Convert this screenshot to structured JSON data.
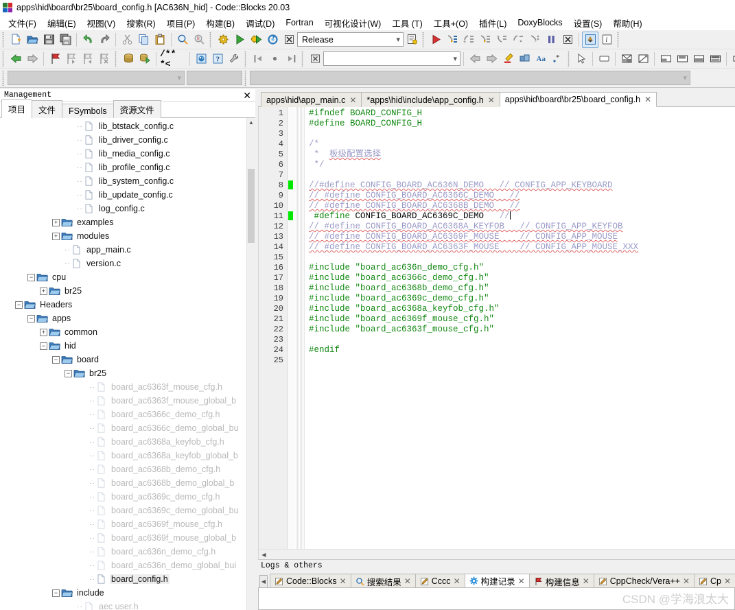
{
  "window": {
    "title": "apps\\hid\\board\\br25\\board_config.h [AC636N_hid] - Code::Blocks 20.03",
    "logo": "codeblocks-logo"
  },
  "menubar": {
    "items": [
      {
        "label": "文件(F)"
      },
      {
        "label": "编辑(E)"
      },
      {
        "label": "视图(V)"
      },
      {
        "label": "搜索(R)"
      },
      {
        "label": "项目(P)"
      },
      {
        "label": "构建(B)"
      },
      {
        "label": "调试(D)"
      },
      {
        "label": "Fortran"
      },
      {
        "label": "可视化设计(W)"
      },
      {
        "label": "工具 (T)"
      },
      {
        "label": "工具+(O)"
      },
      {
        "label": "插件(L)"
      },
      {
        "label": "DoxyBlocks"
      },
      {
        "label": "设置(S)"
      },
      {
        "label": "帮助(H)"
      }
    ]
  },
  "toolbar1": {
    "icons": [
      "new-file-icon",
      "open-file-icon",
      "save-icon",
      "save-all-icon",
      "undo-icon",
      "redo-icon",
      "cut-icon",
      "copy-icon",
      "paste-icon",
      "find-icon",
      "replace-icon"
    ],
    "build_icons": [
      "build-icon",
      "run-icon",
      "build-and-run-icon",
      "rebuild-icon",
      "abort-icon"
    ],
    "target_value": "Release",
    "target_chevron": "chevron-down-icon",
    "build_target_options": [
      "Release"
    ],
    "select_target_icon": "select-target-icon",
    "debug_icons": [
      "debug-continue-icon",
      "debug-next-line-icon",
      "debug-next-instruction-icon",
      "debug-step-into-icon",
      "debug-step-out-icon",
      "debug-step-instruction-icon",
      "debug-run-to-cursor-icon",
      "debug-break-icon",
      "debug-stop-icon"
    ],
    "debug_window_icons": [
      "debugging-windows-icon",
      "various-info-icon"
    ]
  },
  "toolbar2": {
    "nav_icons": [
      "back-icon",
      "forward-icon"
    ],
    "bookmark_icons": [
      "toggle-bookmark-icon",
      "next-bookmark-icon",
      "prev-bookmark-icon",
      "clear-bookmarks-icon"
    ],
    "doxy_icons": [
      "doxyblocks-run-icon",
      "doxyblocks-extract-icon"
    ],
    "comment_icons": [
      "doxy-comment-icon"
    ],
    "doxy_more_icons": [
      "doxyblocks-config-icon",
      "doxyblocks-help-icon",
      "doxyblocks-wizard-icon"
    ],
    "fold_icons": [
      "fold-all-icon",
      "fold-point-icon",
      "unfold-all-icon"
    ],
    "misc_icons": [
      "close-box-icon"
    ],
    "search_value": "",
    "search_chevron": "chevron-down-icon",
    "nav2_icons": [
      "goto-prev-icon",
      "goto-next-icon",
      "highlight-icon",
      "match-case-icon",
      "whole-word-icon",
      "regex-icon"
    ],
    "design_icons": [
      "pointer-icon",
      "panel-icon",
      "split-h-icon",
      "split-diag-icon",
      "dock-bottom-icon",
      "dock-top-icon",
      "dock-fill-icon",
      "dock-split-icon",
      "shape-rect-icon",
      "shape-trapezoid-icon",
      "shape-hex-icon"
    ]
  },
  "toolbar3": {
    "combo1_value": "",
    "combo1_chevron": "chevron-down-icon",
    "combo2_value": "",
    "combo3_value": "",
    "combo3_chevron": "chevron-down-icon"
  },
  "management": {
    "title": "Management",
    "close_icon": "close-icon",
    "tabs": [
      {
        "label": "项目",
        "active": true
      },
      {
        "label": "文件",
        "active": false
      },
      {
        "label": "FSymbols",
        "active": false
      },
      {
        "label": "资源文件",
        "active": false
      }
    ],
    "tree": [
      {
        "label": "lib_btstack_config.c",
        "indent": 7,
        "type": "file",
        "toggle": "none",
        "state": "normal"
      },
      {
        "label": "lib_driver_config.c",
        "indent": 7,
        "type": "file",
        "toggle": "none",
        "state": "normal"
      },
      {
        "label": "lib_media_config.c",
        "indent": 7,
        "type": "file",
        "toggle": "none",
        "state": "normal"
      },
      {
        "label": "lib_profile_config.c",
        "indent": 7,
        "type": "file",
        "toggle": "none",
        "state": "normal"
      },
      {
        "label": "lib_system_config.c",
        "indent": 7,
        "type": "file",
        "toggle": "none",
        "state": "normal"
      },
      {
        "label": "lib_update_config.c",
        "indent": 7,
        "type": "file",
        "toggle": "none",
        "state": "normal"
      },
      {
        "label": "log_config.c",
        "indent": 7,
        "type": "file",
        "toggle": "none",
        "state": "normal"
      },
      {
        "label": "examples",
        "indent": 5,
        "type": "folder",
        "toggle": "plus",
        "state": "normal"
      },
      {
        "label": "modules",
        "indent": 5,
        "type": "folder",
        "toggle": "plus",
        "state": "normal"
      },
      {
        "label": "app_main.c",
        "indent": 6,
        "type": "file",
        "toggle": "none",
        "state": "normal"
      },
      {
        "label": "version.c",
        "indent": 6,
        "type": "file",
        "toggle": "none",
        "state": "normal"
      },
      {
        "label": "cpu",
        "indent": 3,
        "type": "folder",
        "toggle": "minus",
        "state": "normal"
      },
      {
        "label": "br25",
        "indent": 4,
        "type": "folder",
        "toggle": "plus",
        "state": "normal"
      },
      {
        "label": "Headers",
        "indent": 2,
        "type": "folder",
        "toggle": "minus",
        "state": "normal"
      },
      {
        "label": "apps",
        "indent": 3,
        "type": "folder",
        "toggle": "minus",
        "state": "normal"
      },
      {
        "label": "common",
        "indent": 4,
        "type": "folder",
        "toggle": "plus",
        "state": "normal"
      },
      {
        "label": "hid",
        "indent": 4,
        "type": "folder",
        "toggle": "minus",
        "state": "normal"
      },
      {
        "label": "board",
        "indent": 5,
        "type": "folder",
        "toggle": "minus",
        "state": "normal"
      },
      {
        "label": "br25",
        "indent": 6,
        "type": "folder",
        "toggle": "minus",
        "state": "normal"
      },
      {
        "label": "board_ac6363f_mouse_cfg.h",
        "indent": 8,
        "type": "file",
        "toggle": "none",
        "state": "dim"
      },
      {
        "label": "board_ac6363f_mouse_global_b",
        "indent": 8,
        "type": "file",
        "toggle": "none",
        "state": "dim"
      },
      {
        "label": "board_ac6366c_demo_cfg.h",
        "indent": 8,
        "type": "file",
        "toggle": "none",
        "state": "dim"
      },
      {
        "label": "board_ac6366c_demo_global_bu",
        "indent": 8,
        "type": "file",
        "toggle": "none",
        "state": "dim"
      },
      {
        "label": "board_ac6368a_keyfob_cfg.h",
        "indent": 8,
        "type": "file",
        "toggle": "none",
        "state": "dim"
      },
      {
        "label": "board_ac6368a_keyfob_global_b",
        "indent": 8,
        "type": "file",
        "toggle": "none",
        "state": "dim"
      },
      {
        "label": "board_ac6368b_demo_cfg.h",
        "indent": 8,
        "type": "file",
        "toggle": "none",
        "state": "dim"
      },
      {
        "label": "board_ac6368b_demo_global_b",
        "indent": 8,
        "type": "file",
        "toggle": "none",
        "state": "dim"
      },
      {
        "label": "board_ac6369c_demo_cfg.h",
        "indent": 8,
        "type": "file",
        "toggle": "none",
        "state": "dim"
      },
      {
        "label": "board_ac6369c_demo_global_bu",
        "indent": 8,
        "type": "file",
        "toggle": "none",
        "state": "dim"
      },
      {
        "label": "board_ac6369f_mouse_cfg.h",
        "indent": 8,
        "type": "file",
        "toggle": "none",
        "state": "dim"
      },
      {
        "label": "board_ac6369f_mouse_global_b",
        "indent": 8,
        "type": "file",
        "toggle": "none",
        "state": "dim"
      },
      {
        "label": "board_ac636n_demo_cfg.h",
        "indent": 8,
        "type": "file",
        "toggle": "none",
        "state": "dim"
      },
      {
        "label": "board_ac636n_demo_global_bui",
        "indent": 8,
        "type": "file",
        "toggle": "none",
        "state": "dim"
      },
      {
        "label": "board_config.h",
        "indent": 8,
        "type": "file",
        "toggle": "none",
        "state": "selected"
      },
      {
        "label": "include",
        "indent": 5,
        "type": "folder",
        "toggle": "minus",
        "state": "normal"
      },
      {
        "label": "aec user.h",
        "indent": 7,
        "type": "file",
        "toggle": "none",
        "state": "dim"
      }
    ]
  },
  "editor": {
    "tabs": [
      {
        "label": "apps\\hid\\app_main.c",
        "close_icon": "close-icon",
        "active": false
      },
      {
        "label": "*apps\\hid\\include\\app_config.h",
        "close_icon": "close-icon",
        "active": false
      },
      {
        "label": "apps\\hid\\board\\br25\\board_config.h",
        "close_icon": "close-icon",
        "active": true
      }
    ],
    "first_line": 1,
    "last_line": 25,
    "bookmark_lines": [
      8,
      11
    ],
    "lines": [
      {
        "n": 1,
        "tokens": [
          {
            "t": "#ifndef BOARD_CONFIG_H",
            "c": "c-pre"
          }
        ]
      },
      {
        "n": 2,
        "tokens": [
          {
            "t": "#define BOARD_CONFIG_H",
            "c": "c-pre"
          }
        ]
      },
      {
        "n": 3,
        "tokens": []
      },
      {
        "n": 4,
        "tokens": [
          {
            "t": "/*",
            "c": "c-cmt"
          }
        ]
      },
      {
        "n": 5,
        "tokens": [
          {
            "t": " *  ",
            "c": "c-cmt"
          },
          {
            "t": "板级配置选择",
            "c": "c-cmt squig"
          }
        ]
      },
      {
        "n": 6,
        "tokens": [
          {
            "t": " */",
            "c": "c-cmt"
          }
        ]
      },
      {
        "n": 7,
        "tokens": []
      },
      {
        "n": 8,
        "tokens": [
          {
            "t": "//#define CONFIG_BOARD_AC636N_DEMO   // CONFIG_APP_KEYBOARD",
            "c": "c-cmt squig"
          }
        ]
      },
      {
        "n": 9,
        "tokens": [
          {
            "t": "// #define CONFIG_BOARD_AC6366C_DEMO   //",
            "c": "c-cmt squig"
          }
        ]
      },
      {
        "n": 10,
        "tokens": [
          {
            "t": "// #define CONFIG_BOARD_AC6368B_DEMO   //",
            "c": "c-cmt squig"
          }
        ]
      },
      {
        "n": 11,
        "tokens": [
          {
            "t": " ",
            "c": "c-id"
          },
          {
            "t": "#define",
            "c": "c-pre"
          },
          {
            "t": " CONFIG_BOARD_AC6369C_DEMO",
            "c": "c-id"
          },
          {
            "t": "   ",
            "c": "c-id"
          },
          {
            "t": "//",
            "c": "c-cmt"
          },
          {
            "t": "|CARET|",
            "c": "caret"
          }
        ]
      },
      {
        "n": 12,
        "tokens": [
          {
            "t": "// #define CONFIG_BOARD_AC6368A_KEYFOB   // CONFIG_APP_KEYFOB",
            "c": "c-cmt squig"
          }
        ]
      },
      {
        "n": 13,
        "tokens": [
          {
            "t": "// #define CONFIG_BOARD_AC6369F_MOUSE    // CONFIG_APP_MOUSE",
            "c": "c-cmt squig"
          }
        ]
      },
      {
        "n": 14,
        "tokens": [
          {
            "t": "// #define CONFIG_BOARD_AC6363F_MOUSE    // CONFIG_APP_MOUSE_XXX",
            "c": "c-cmt squig"
          }
        ]
      },
      {
        "n": 15,
        "tokens": []
      },
      {
        "n": 16,
        "tokens": [
          {
            "t": "#include \"board_ac636n_demo_cfg.h\"",
            "c": "c-pre"
          }
        ]
      },
      {
        "n": 17,
        "tokens": [
          {
            "t": "#include \"board_ac6366c_demo_cfg.h\"",
            "c": "c-pre"
          }
        ]
      },
      {
        "n": 18,
        "tokens": [
          {
            "t": "#include \"board_ac6368b_demo_cfg.h\"",
            "c": "c-pre"
          }
        ]
      },
      {
        "n": 19,
        "tokens": [
          {
            "t": "#include \"board_ac6369c_demo_cfg.h\"",
            "c": "c-pre"
          }
        ]
      },
      {
        "n": 20,
        "tokens": [
          {
            "t": "#include \"board_ac6368a_keyfob_cfg.h\"",
            "c": "c-pre"
          }
        ]
      },
      {
        "n": 21,
        "tokens": [
          {
            "t": "#include \"board_ac6369f_mouse_cfg.h\"",
            "c": "c-pre"
          }
        ]
      },
      {
        "n": 22,
        "tokens": [
          {
            "t": "#include \"board_ac6363f_mouse_cfg.h\"",
            "c": "c-pre"
          }
        ]
      },
      {
        "n": 23,
        "tokens": []
      },
      {
        "n": 24,
        "tokens": [
          {
            "t": "#endif",
            "c": "c-pre"
          }
        ]
      },
      {
        "n": 25,
        "tokens": []
      }
    ]
  },
  "logs": {
    "title": "Logs & others",
    "scroll_left_icon": "chevron-left-icon",
    "tabs": [
      {
        "label": "Code::Blocks",
        "icon": "pencil-icon",
        "close_icon": "close-icon",
        "active": false
      },
      {
        "label": "搜索结果",
        "icon": "magnifier-icon",
        "close_icon": "close-icon",
        "active": false
      },
      {
        "label": "Cccc",
        "icon": "pencil-icon",
        "close_icon": "close-icon",
        "active": false
      },
      {
        "label": "构建记录",
        "icon": "gear-icon",
        "close_icon": "close-icon",
        "active": true
      },
      {
        "label": "构建信息",
        "icon": "flag-icon",
        "close_icon": "close-icon",
        "active": false
      },
      {
        "label": "CppCheck/Vera++",
        "icon": "pencil-icon",
        "close_icon": "close-icon",
        "active": false
      },
      {
        "label": "Cp",
        "icon": "pencil-icon",
        "close_icon": "close-icon",
        "active": false
      }
    ],
    "watermark": "CSDN @学海浪太大"
  }
}
